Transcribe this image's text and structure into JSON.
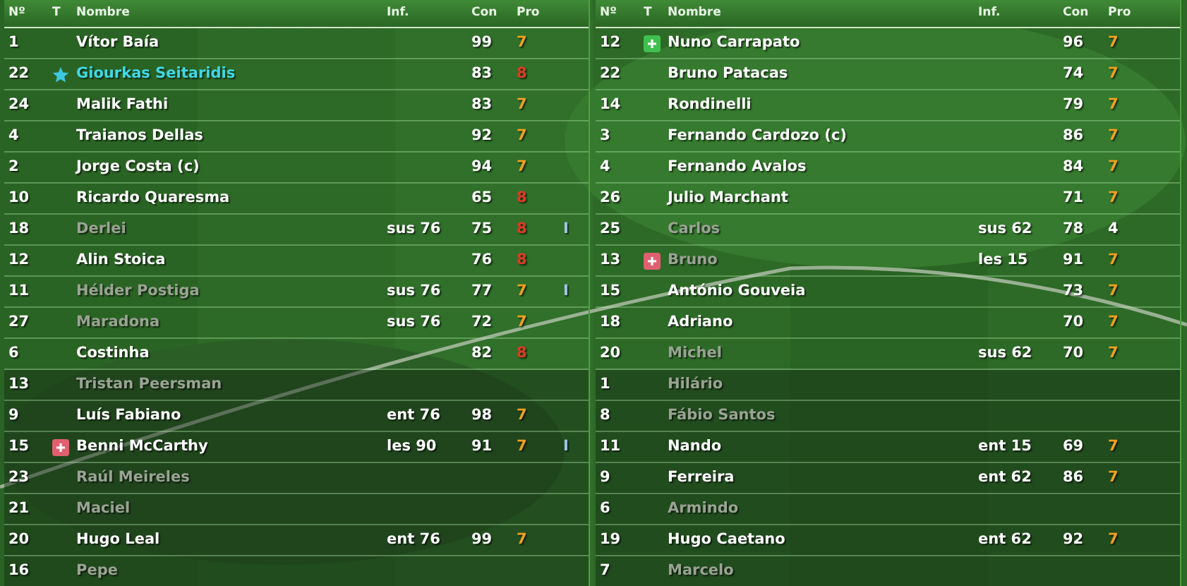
{
  "panels": [
    {
      "columns": [
        "Nº",
        "T",
        "Nombre",
        "Inf.",
        "Con",
        "Pro"
      ],
      "rows": [
        {
          "number": "1",
          "name": "Vítor Baía",
          "available": true,
          "highlighted": false,
          "starter": true,
          "con": "99",
          "pro": "7",
          "color": "#f0a020"
        },
        {
          "number": "22",
          "kind": "star",
          "name": "Giourkas Seitaridis",
          "available": true,
          "highlighted": true,
          "starter": true,
          "con": "83",
          "pro": "8",
          "color": "#e03a22"
        },
        {
          "number": "24",
          "name": "Malik Fathi",
          "available": true,
          "highlighted": false,
          "starter": true,
          "con": "83",
          "pro": "7",
          "color": "#f0a020"
        },
        {
          "number": "4",
          "name": "Traianos Dellas",
          "available": true,
          "highlighted": false,
          "starter": true,
          "con": "92",
          "pro": "7",
          "color": "#f0a020"
        },
        {
          "number": "2",
          "name": "Jorge Costa (c)",
          "available": true,
          "highlighted": false,
          "starter": true,
          "con": "94",
          "pro": "7",
          "color": "#f0a020"
        },
        {
          "number": "10",
          "name": "Ricardo Quaresma",
          "available": true,
          "highlighted": false,
          "starter": true,
          "con": "65",
          "pro": "8",
          "color": "#e03a22"
        },
        {
          "number": "18",
          "name": "Derlei",
          "available": false,
          "highlighted": false,
          "starter": true,
          "info": "sus 76",
          "con": "75",
          "pro": "8",
          "color": "#e03a22",
          "extra": "I"
        },
        {
          "number": "12",
          "name": "Alin Stoica",
          "available": true,
          "highlighted": false,
          "starter": true,
          "con": "76",
          "pro": "8",
          "color": "#e03a22"
        },
        {
          "number": "11",
          "name": "Hélder Postiga",
          "available": false,
          "highlighted": false,
          "starter": true,
          "info": "sus 76",
          "con": "77",
          "pro": "7",
          "color": "#f0a020",
          "extra": "I"
        },
        {
          "number": "27",
          "name": "Maradona",
          "available": false,
          "highlighted": false,
          "starter": true,
          "info": "sus 76",
          "con": "72",
          "pro": "7",
          "color": "#f0a020"
        },
        {
          "number": "6",
          "name": "Costinha",
          "available": true,
          "highlighted": false,
          "starter": true,
          "con": "82",
          "pro": "8",
          "color": "#e03a22"
        },
        {
          "number": "13",
          "name": "Tristan Peersman",
          "available": false,
          "highlighted": false,
          "starter": false
        },
        {
          "number": "9",
          "name": "Luís Fabiano",
          "available": true,
          "highlighted": false,
          "starter": false,
          "info": "ent 76",
          "con": "98",
          "pro": "7",
          "color": "#f0a020"
        },
        {
          "number": "15",
          "kind": "injury",
          "name": "Benni McCarthy",
          "available": true,
          "highlighted": false,
          "starter": false,
          "info": "les 90",
          "con": "91",
          "pro": "7",
          "color": "#f0a020",
          "extra": "I"
        },
        {
          "number": "23",
          "name": "Raúl Meireles",
          "available": false,
          "highlighted": false,
          "starter": false
        },
        {
          "number": "21",
          "name": "Maciel",
          "available": false,
          "highlighted": false,
          "starter": false
        },
        {
          "number": "20",
          "name": "Hugo Leal",
          "available": true,
          "highlighted": false,
          "starter": false,
          "info": "ent 76",
          "con": "99",
          "pro": "7",
          "color": "#f0a020"
        },
        {
          "number": "16",
          "name": "Pepe",
          "available": false,
          "highlighted": false,
          "starter": false
        }
      ]
    },
    {
      "columns": [
        "Nº",
        "T",
        "Nombre",
        "Inf.",
        "Con",
        "Pro"
      ],
      "rows": [
        {
          "number": "12",
          "kind": "fitness",
          "name": "Nuno Carrapato",
          "available": true,
          "highlighted": false,
          "starter": true,
          "con": "96",
          "pro": "7",
          "color": "#f0a020"
        },
        {
          "number": "22",
          "name": "Bruno Patacas",
          "available": true,
          "highlighted": false,
          "starter": true,
          "con": "74",
          "pro": "7",
          "color": "#f0a020"
        },
        {
          "number": "14",
          "name": "Rondinelli",
          "available": true,
          "highlighted": false,
          "starter": true,
          "con": "79",
          "pro": "7",
          "color": "#f0a020"
        },
        {
          "number": "3",
          "name": "Fernando Cardozo (c)",
          "available": true,
          "highlighted": false,
          "starter": true,
          "con": "86",
          "pro": "7",
          "color": "#f0a020"
        },
        {
          "number": "4",
          "name": "Fernando Avalos",
          "available": true,
          "highlighted": false,
          "starter": true,
          "con": "84",
          "pro": "7",
          "color": "#f0a020"
        },
        {
          "number": "26",
          "name": "Julio Marchant",
          "available": true,
          "highlighted": false,
          "starter": true,
          "con": "71",
          "pro": "7",
          "color": "#f0a020"
        },
        {
          "number": "25",
          "name": "Carlos",
          "available": false,
          "highlighted": false,
          "starter": true,
          "info": "sus 62",
          "con": "78",
          "pro": "4",
          "color": "#ffffff"
        },
        {
          "number": "13",
          "kind": "injury",
          "name": "Bruno",
          "available": false,
          "highlighted": false,
          "starter": true,
          "info": "les 15",
          "con": "91",
          "pro": "7",
          "color": "#f0a020"
        },
        {
          "number": "15",
          "name": "António Gouveia",
          "available": true,
          "highlighted": false,
          "starter": true,
          "con": "73",
          "pro": "7",
          "color": "#f0a020"
        },
        {
          "number": "18",
          "name": "Adriano",
          "available": true,
          "highlighted": false,
          "starter": true,
          "con": "70",
          "pro": "7",
          "color": "#f0a020"
        },
        {
          "number": "20",
          "name": "Michel",
          "available": false,
          "highlighted": false,
          "starter": true,
          "info": "sus 62",
          "con": "70",
          "pro": "7",
          "color": "#f0a020"
        },
        {
          "number": "1",
          "name": "Hilário",
          "available": false,
          "highlighted": false,
          "starter": false
        },
        {
          "number": "8",
          "name": "Fábio Santos",
          "available": false,
          "highlighted": false,
          "starter": false
        },
        {
          "number": "11",
          "name": "Nando",
          "available": true,
          "highlighted": false,
          "starter": false,
          "info": "ent 15",
          "con": "69",
          "pro": "7",
          "color": "#f0a020"
        },
        {
          "number": "9",
          "name": "Ferreira",
          "available": true,
          "highlighted": false,
          "starter": false,
          "info": "ent 62",
          "con": "86",
          "pro": "7",
          "color": "#f0a020"
        },
        {
          "number": "6",
          "name": "Armindo",
          "available": false,
          "highlighted": false,
          "starter": false
        },
        {
          "number": "19",
          "name": "Hugo Caetano",
          "available": true,
          "highlighted": false,
          "starter": false,
          "info": "ent 62",
          "con": "92",
          "pro": "7",
          "color": "#f0a020"
        },
        {
          "number": "7",
          "name": "Marcelo",
          "available": false,
          "highlighted": false,
          "starter": false
        }
      ]
    }
  ]
}
